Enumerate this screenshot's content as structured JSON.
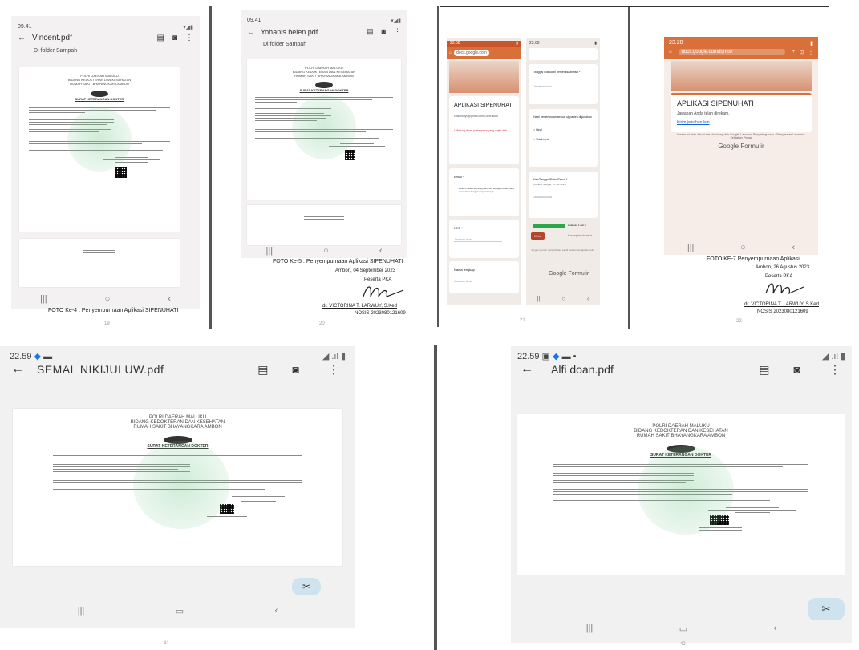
{
  "panel1": {
    "time": "09.41",
    "title": "Vincent.pdf",
    "subtitle": "Di folder Sampah",
    "caption": "FOTO Ke-4 : Penyempurnaan Aplikasi SIPENUHATI",
    "page_number": "19"
  },
  "panel2": {
    "time": "09.41",
    "title": "Yohanis belen.pdf",
    "subtitle": "Di folder Sampah",
    "caption": "FOTO Ke-5 : Penyempurnaan Aplikasi SIPENUHATI",
    "date_line": "Ambon, 04 September 2023",
    "role": "Peserta PKA",
    "name": "dr. VICTORINA T. LARWUY, S.Ked",
    "nosis": "NOSIS 2023080121609",
    "page_number": "20"
  },
  "panel3": {
    "left_time": "23.08",
    "right_time": "23.08",
    "url": "docs.google.com",
    "form_title": "APLIKASI SIPENUHATI",
    "email_text": "vifalarwuy9@gmail.com Ganti akun",
    "required_note": "* Menunjukkan pertanyaan yang wajib diisi",
    "q_email": "Email *",
    "q_email_opt": "Rekam vifalarwuy9@gmail.com sebagai email yang disertakan dengan respons saya",
    "q_nrp": "NRP *",
    "answer_placeholder": "Jawaban Anda",
    "q_nama": "Nama lengkap *",
    "q_date_prev": "Tanggal dilakukan pemeriksaan fisik *",
    "q_hasil": "Hasil pemeriksaan sesuai uji pasien digunakan",
    "opt_yes": "Ideal",
    "opt_no": "Tidak ideal",
    "q_birth": "Hari/Tanggal/Bulan/Tahun *",
    "q_birth_hint": "(Contoh: Minggu, 15 Juli 2023)",
    "progress_label": "Halaman 1 dari 1",
    "submit": "Kirim",
    "clear": "Kosongkan formulir",
    "footer_note": "Jangan pernah mengirimkan sandi melalui Google Formulir",
    "gforms": "Google Formulir",
    "page_number": "21"
  },
  "panel4": {
    "time": "23.28",
    "url": "docs.google.com/forms/",
    "form_title": "APLIKASI SIPENUHATI",
    "response_text": "Jawaban Anda telah direkam.",
    "link_text": "Kirim jawaban lain",
    "disclaimer": "Konten ini tidak dibuat atau didukung oleh Google. Laporkan Penyalahgunaan · Persyaratan Layanan · Kebijakan Privasi",
    "gforms": "Google Formulir",
    "caption": "FOTO KE-7 Penyempurnaan Aplikasi",
    "date_line": "Ambon, 26 Agustus 2023",
    "role": "Peserta PKA",
    "name": "dr. VICTORINA T. LARWUY, S.Ked",
    "nosis": "NOSIS 2023080121609",
    "page_number": "22"
  },
  "panel5": {
    "time": "22.59",
    "title": "SEMAL NIKIJULUW.pdf",
    "page_number": "41"
  },
  "panel6": {
    "time": "22.59",
    "title": "Alfi doan.pdf",
    "page_number": "42"
  },
  "doc_common": {
    "org1": "POLRI DAERAH MALUKU",
    "org2": "BIDANG KEDOKTERAN DAN KESEHATAN",
    "org3": "RUMAH SAKIT BHAYANGKARA AMBON",
    "doc_title": "SURAT KETERANGAN DOKTER"
  },
  "colors": {
    "form_orange": "#d9703a",
    "gforms_green": "#2aa84a",
    "submit_red": "#b5452a",
    "fab_bg": "#cfe3ee"
  }
}
